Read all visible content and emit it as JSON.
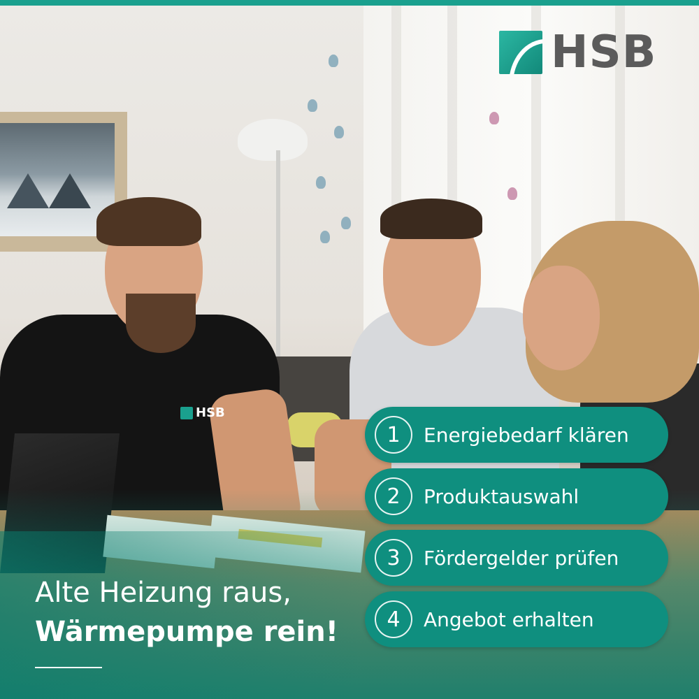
{
  "brand": {
    "name": "HSB",
    "shirt_logo": "HSB",
    "accent_color": "#1aa08e",
    "text_color": "#5b5b5b"
  },
  "steps": [
    {
      "number": "1",
      "label": "Energiebedarf klären"
    },
    {
      "number": "2",
      "label": "Produktauswahl"
    },
    {
      "number": "3",
      "label": "Fördergelder prüfen"
    },
    {
      "number": "4",
      "label": "Angebot erhalten"
    }
  ],
  "headline": {
    "line1": "Alte Heizung raus,",
    "line2": "Wärmepumpe rein!"
  },
  "photo": {
    "scene_elements": [
      "painting",
      "floor-lamp",
      "butterflies",
      "sofa",
      "laptop",
      "documents",
      "table"
    ]
  }
}
